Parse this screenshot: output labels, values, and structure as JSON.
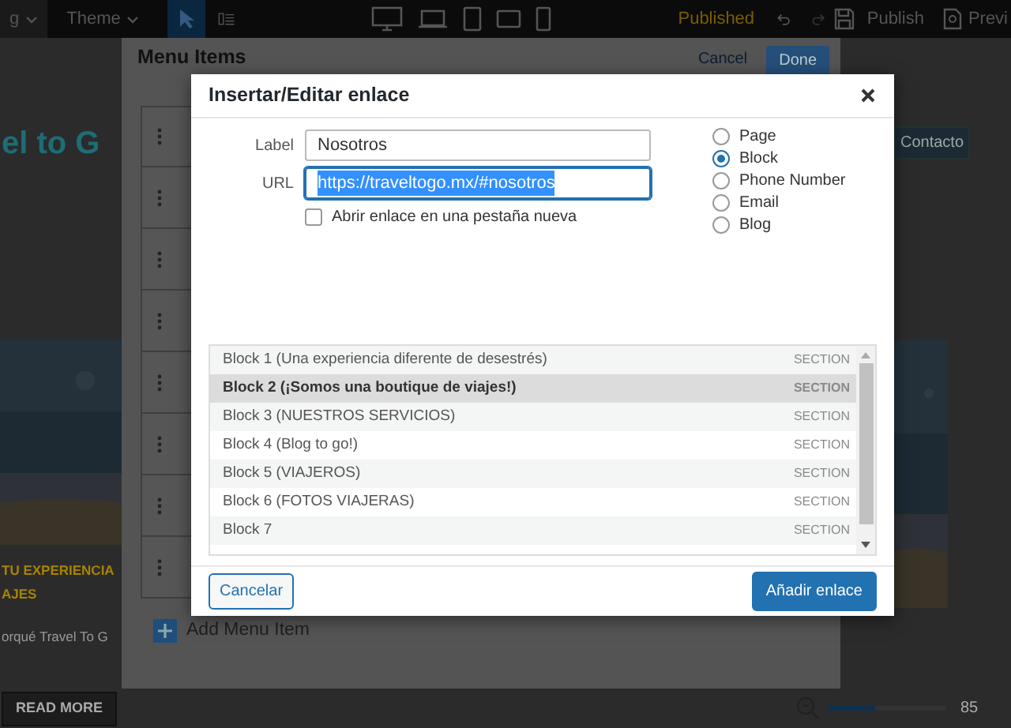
{
  "toolbar": {
    "left_menu": "g",
    "theme_menu": "Theme",
    "status": "Published",
    "publish": "Publish",
    "preview": "Previ"
  },
  "site": {
    "logo": "el to G",
    "contact": "Contacto",
    "headline": [
      "TU EXPERIENCIA",
      "AJES"
    ],
    "teaser": "orqué Travel To G",
    "read_more": "READ MORE",
    "zoom_value": "85",
    "zoom": {
      "level": 0.4
    }
  },
  "menu_panel": {
    "title": "Menu Items",
    "cancel": "Cancel",
    "done": "Done",
    "items": [
      {
        "drag_handle": true
      },
      {
        "drag_handle": true
      },
      {
        "drag_handle": true
      },
      {
        "drag_handle": true
      },
      {
        "drag_handle": true
      },
      {
        "drag_handle": true
      },
      {
        "drag_handle": true
      },
      {
        "drag_handle": true
      }
    ],
    "add_item": "Add Menu Item"
  },
  "dialog": {
    "title": "Insertar/Editar enlace",
    "label_caption": "Label",
    "label_value": "Nosotros",
    "url_caption": "URL",
    "url_value": "https://traveltogo.mx/#nosotros",
    "new_tab": {
      "label": "Abrir enlace en una pestaña nueva",
      "checked": false
    },
    "link_types": [
      {
        "label": "Page",
        "selected": false
      },
      {
        "label": "Block",
        "selected": true
      },
      {
        "label": "Phone Number",
        "selected": false
      },
      {
        "label": "Email",
        "selected": false
      },
      {
        "label": "Blog",
        "selected": false
      }
    ],
    "blocks": [
      {
        "name": "Block 1 (Una experiencia diferente de desestrés)",
        "type": "SECTION",
        "selected": false
      },
      {
        "name": "Block 2 (¡Somos una boutique de viajes!)",
        "type": "SECTION",
        "selected": true
      },
      {
        "name": "Block 3 (NUESTROS SERVICIOS)",
        "type": "SECTION",
        "selected": false
      },
      {
        "name": "Block 4 (Blog to go!)",
        "type": "SECTION",
        "selected": false
      },
      {
        "name": "Block 5 (VIAJEROS)",
        "type": "SECTION",
        "selected": false
      },
      {
        "name": "Block 6 (FOTOS VIAJERAS)",
        "type": "SECTION",
        "selected": false
      },
      {
        "name": "Block 7",
        "type": "SECTION",
        "selected": false
      }
    ],
    "cancel": "Cancelar",
    "submit": "Añadir enlace"
  }
}
